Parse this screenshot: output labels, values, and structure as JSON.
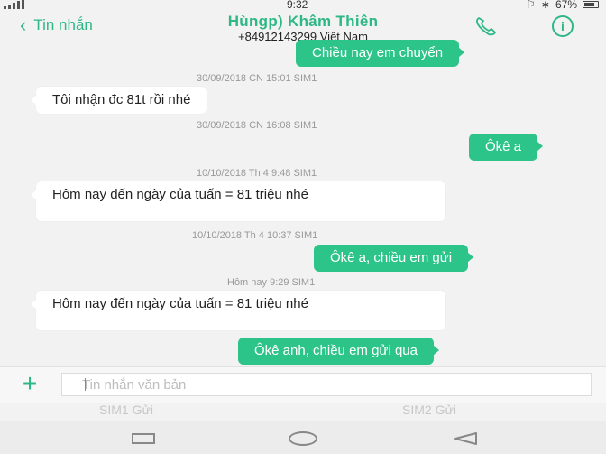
{
  "status_bar": {
    "time": "9:32",
    "battery": "67%"
  },
  "header": {
    "back_label": "Tin nhắn",
    "contact_name": "Hùngp) Khâm Thiên",
    "contact_phone": "+84912143299  Việt Nam"
  },
  "messages": [
    {
      "dir": "out",
      "text": "Chiều nay em chuyển"
    },
    {
      "dir": "ts",
      "text": "30/09/2018 CN 15:01  SIM1"
    },
    {
      "dir": "in",
      "text": "Tôi nhận đc 81t rồi nhé"
    },
    {
      "dir": "ts",
      "text": "30/09/2018 CN 16:08  SIM1"
    },
    {
      "dir": "out",
      "text": "Ôkê a"
    },
    {
      "dir": "ts",
      "text": "10/10/2018 Th 4 9:48  SIM1"
    },
    {
      "dir": "in",
      "text": " Hôm nay đến ngày của tuấn = 81 triệu nhé"
    },
    {
      "dir": "ts",
      "text": "10/10/2018 Th 4 10:37  SIM1"
    },
    {
      "dir": "out",
      "text": "Ôkê a, chiều em gửi"
    },
    {
      "dir": "ts",
      "text": "Hôm nay 9:29  SIM1"
    },
    {
      "dir": "in",
      "text": " Hôm nay đến ngày của tuấn = 81 triệu nhé"
    },
    {
      "dir": "out",
      "text": "Ôkê anh, chiều em gửi qua"
    }
  ],
  "composer": {
    "placeholder": "Tin nhắn văn bản",
    "sim1_send": "SIM1 Gửi",
    "sim2_send": "SIM2 Gửi"
  },
  "colors": {
    "accent": "#2db886",
    "outgoing_bubble": "#2dc489",
    "incoming_bubble": "#ffffff"
  },
  "icons": {
    "back": "chevron-left-icon",
    "call": "phone-icon",
    "info": "info-icon",
    "add": "plus-icon"
  }
}
